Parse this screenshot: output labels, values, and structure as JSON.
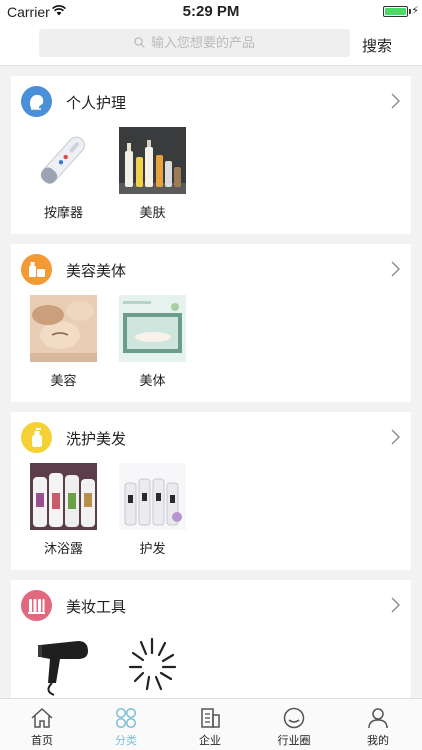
{
  "status_bar": {
    "carrier": "Carrier",
    "time": "5:29 PM"
  },
  "search": {
    "placeholder": "输入您想要的产品",
    "button_label": "搜索"
  },
  "categories": [
    {
      "title": "个人护理",
      "icon": "face-icon",
      "color": "#4a90d9",
      "items": [
        {
          "label": "按摩器",
          "image": "massager-image"
        },
        {
          "label": "美肤",
          "image": "skincare-bottles-image"
        }
      ]
    },
    {
      "title": "美容美体",
      "icon": "cosmetic-icon",
      "color": "#f39a34",
      "items": [
        {
          "label": "美容",
          "image": "facial-treatment-image"
        },
        {
          "label": "美体",
          "image": "body-spa-image"
        }
      ]
    },
    {
      "title": "洗护美发",
      "icon": "shampoo-bottle-icon",
      "color": "#f5d135",
      "items": [
        {
          "label": "沐浴露",
          "image": "shower-gel-image"
        },
        {
          "label": "护发",
          "image": "hair-care-bottles-image"
        }
      ]
    },
    {
      "title": "美妆工具",
      "icon": "brushes-icon",
      "color": "#e0687f",
      "items": [
        {
          "label": "",
          "image": "hair-dryer-image"
        },
        {
          "label": "",
          "image": "eyelash-curler-image"
        }
      ]
    }
  ],
  "tabs": [
    {
      "label": "首页",
      "icon": "home-icon",
      "active": false
    },
    {
      "label": "分类",
      "icon": "category-icon",
      "active": true
    },
    {
      "label": "企业",
      "icon": "building-icon",
      "active": false
    },
    {
      "label": "行业圈",
      "icon": "smile-circle-icon",
      "active": false
    },
    {
      "label": "我的",
      "icon": "person-icon",
      "active": false
    }
  ],
  "colors": {
    "accent": "#7dbfd6",
    "battery": "#4cd964"
  }
}
